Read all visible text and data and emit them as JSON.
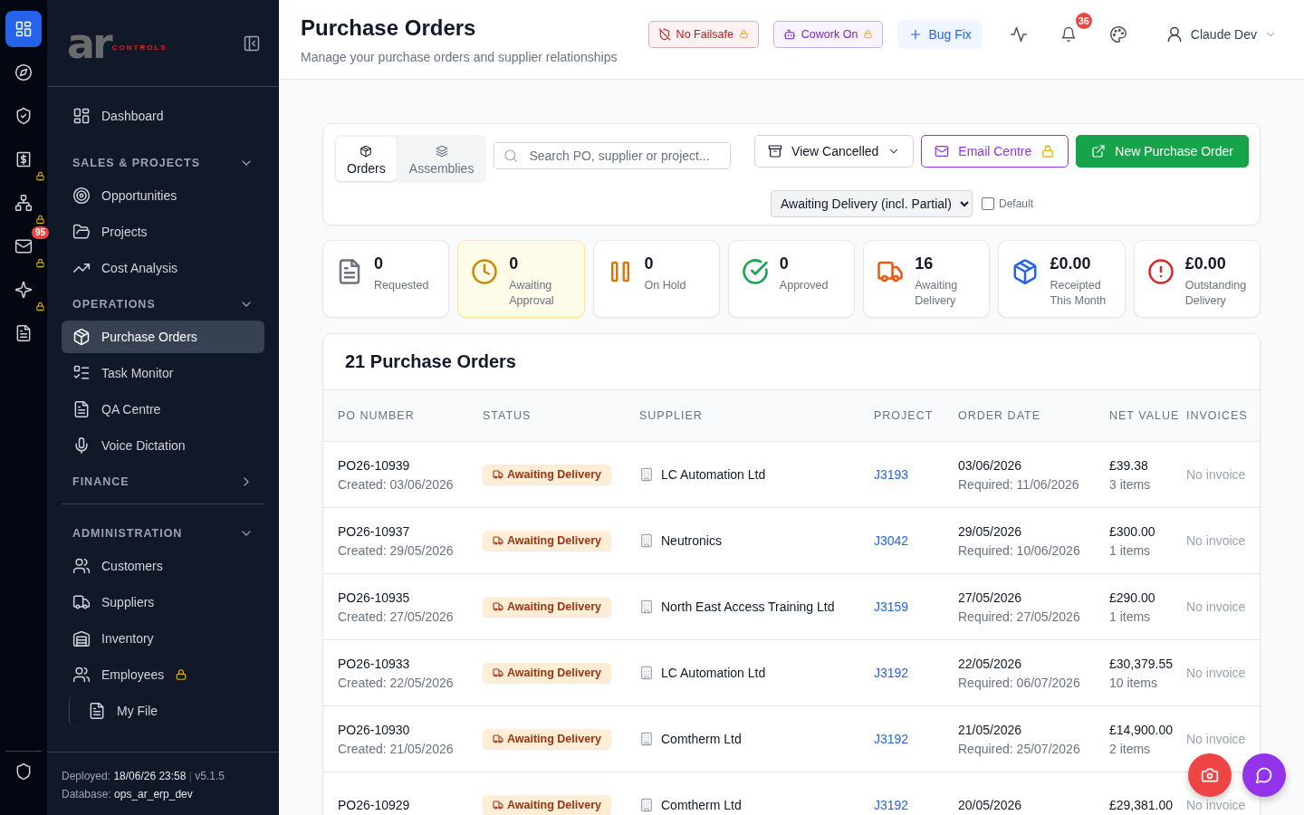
{
  "rail": {
    "items": [
      {
        "selected": true,
        "locked": false
      },
      {
        "selected": false,
        "locked": false
      },
      {
        "selected": false,
        "locked": false
      },
      {
        "selected": false,
        "locked": true
      },
      {
        "selected": false,
        "locked": true
      },
      {
        "selected": false,
        "locked": true,
        "badge": "95"
      },
      {
        "selected": false,
        "locked": true
      },
      {
        "selected": false,
        "locked": false
      }
    ]
  },
  "logo": {
    "mark": "ar",
    "sub": "CONTROLS"
  },
  "sidebar": {
    "items": [
      {
        "label": "Dashboard",
        "selected": false
      }
    ],
    "sections": [
      {
        "title": "SALES & PROJECTS",
        "expanded": true,
        "items": [
          {
            "label": "Opportunities",
            "selected": false
          },
          {
            "label": "Projects",
            "selected": false
          },
          {
            "label": "Cost Analysis",
            "selected": false
          }
        ]
      },
      {
        "title": "OPERATIONS",
        "expanded": true,
        "items": [
          {
            "label": "Purchase Orders",
            "selected": true
          },
          {
            "label": "Task Monitor",
            "selected": false
          },
          {
            "label": "QA Centre",
            "selected": false
          },
          {
            "label": "Voice Dictation",
            "selected": false
          }
        ]
      },
      {
        "title": "FINANCE",
        "expanded": false
      },
      {
        "title": "ADMINISTRATION",
        "expanded": true,
        "items": [
          {
            "label": "Customers",
            "selected": false,
            "locked": false
          },
          {
            "label": "Suppliers",
            "selected": false,
            "locked": false
          },
          {
            "label": "Inventory",
            "selected": false,
            "locked": false
          },
          {
            "label": "Employees",
            "selected": false,
            "locked": true,
            "children": [
              {
                "label": "My File",
                "selected": false
              }
            ]
          }
        ]
      }
    ],
    "footer": {
      "deployed_label": "Deployed:",
      "deployed": "18/06/26 23:58",
      "separator": "|",
      "version": "v5.1.5",
      "database_label": "Database:",
      "database": "ops_ar_erp_dev"
    }
  },
  "header": {
    "title": "Purchase Orders",
    "subtitle": "Manage your purchase orders and supplier relationships",
    "chips": [
      {
        "label": "No Failsafe",
        "locked": true,
        "color": "#b91c1c"
      },
      {
        "label": "Cowork On",
        "locked": true,
        "color": "#7e22ce"
      }
    ],
    "bug_fix": "Bug Fix",
    "notifications": "36",
    "user": "Claude Dev"
  },
  "toolbar": {
    "tabs": [
      {
        "label": "Orders",
        "selected": true
      },
      {
        "label": "Assemblies",
        "selected": false
      }
    ],
    "search": {
      "placeholder": "Search PO, supplier or project..."
    },
    "view_cancelled": "View Cancelled",
    "email_centre": {
      "label": "Email Centre",
      "locked": true
    },
    "new_order": "New Purchase Order",
    "status_filter": "Awaiting Delivery (incl. Partial)",
    "default_option": {
      "label": "Default",
      "checked": false
    }
  },
  "stats": [
    {
      "value": "0",
      "label": "Requested",
      "color": "#6b7280",
      "selected": false
    },
    {
      "value": "0",
      "label": "Awaiting Approval",
      "color": "#ca8a04",
      "selected": true
    },
    {
      "value": "0",
      "label": "On Hold",
      "color": "#d97706",
      "selected": false
    },
    {
      "value": "0",
      "label": "Approved",
      "color": "#16a34a",
      "selected": false
    },
    {
      "value": "16",
      "label": "Awaiting Delivery",
      "color": "#ea580c",
      "selected": false
    },
    {
      "value": "£0.00",
      "label": "Receipted This Month",
      "color": "#2563eb",
      "selected": false
    },
    {
      "value": "£0.00",
      "label": "Outstanding Delivery",
      "color": "#dc2626",
      "selected": false
    }
  ],
  "table": {
    "title": "21 Purchase Orders",
    "columns": [
      "PO NUMBER",
      "STATUS",
      "SUPPLIER",
      "PROJECT",
      "ORDER DATE",
      "NET VALUE",
      "INVOICES"
    ],
    "rows": [
      {
        "po": "PO26-10939",
        "created": "Created: 03/06/2026",
        "status": "Awaiting Delivery",
        "supplier": "LC Automation Ltd",
        "project": "J3193",
        "order_date": "03/06/2026",
        "required": "Required: 11/06/2026",
        "net": "£39.38",
        "items": "3 items",
        "invoices": "No invoice"
      },
      {
        "po": "PO26-10937",
        "created": "Created: 29/05/2026",
        "status": "Awaiting Delivery",
        "supplier": "Neutronics",
        "project": "J3042",
        "order_date": "29/05/2026",
        "required": "Required: 10/06/2026",
        "net": "£300.00",
        "items": "1 items",
        "invoices": "No invoice"
      },
      {
        "po": "PO26-10935",
        "created": "Created: 27/05/2026",
        "status": "Awaiting Delivery",
        "supplier": "North East Access Training Ltd",
        "project": "J3159",
        "order_date": "27/05/2026",
        "required": "Required: 27/05/2026",
        "net": "£290.00",
        "items": "1 items",
        "invoices": "No invoice"
      },
      {
        "po": "PO26-10933",
        "created": "Created: 22/05/2026",
        "status": "Awaiting Delivery",
        "supplier": "LC Automation Ltd",
        "project": "J3192",
        "order_date": "22/05/2026",
        "required": "Required: 06/07/2026",
        "net": "£30,379.55",
        "items": "10 items",
        "invoices": "No invoice"
      },
      {
        "po": "PO26-10930",
        "created": "Created: 21/05/2026",
        "status": "Awaiting Delivery",
        "supplier": "Comtherm Ltd",
        "project": "J3192",
        "order_date": "21/05/2026",
        "required": "Required: 25/07/2026",
        "net": "£14,900.00",
        "items": "2 items",
        "invoices": "No invoice"
      },
      {
        "po": "PO26-10929",
        "status": "Awaiting Delivery",
        "supplier": "Comtherm Ltd",
        "project": "J3192",
        "order_date": "20/05/2026",
        "net": "£29,381.00",
        "invoices": "No invoice"
      }
    ]
  }
}
